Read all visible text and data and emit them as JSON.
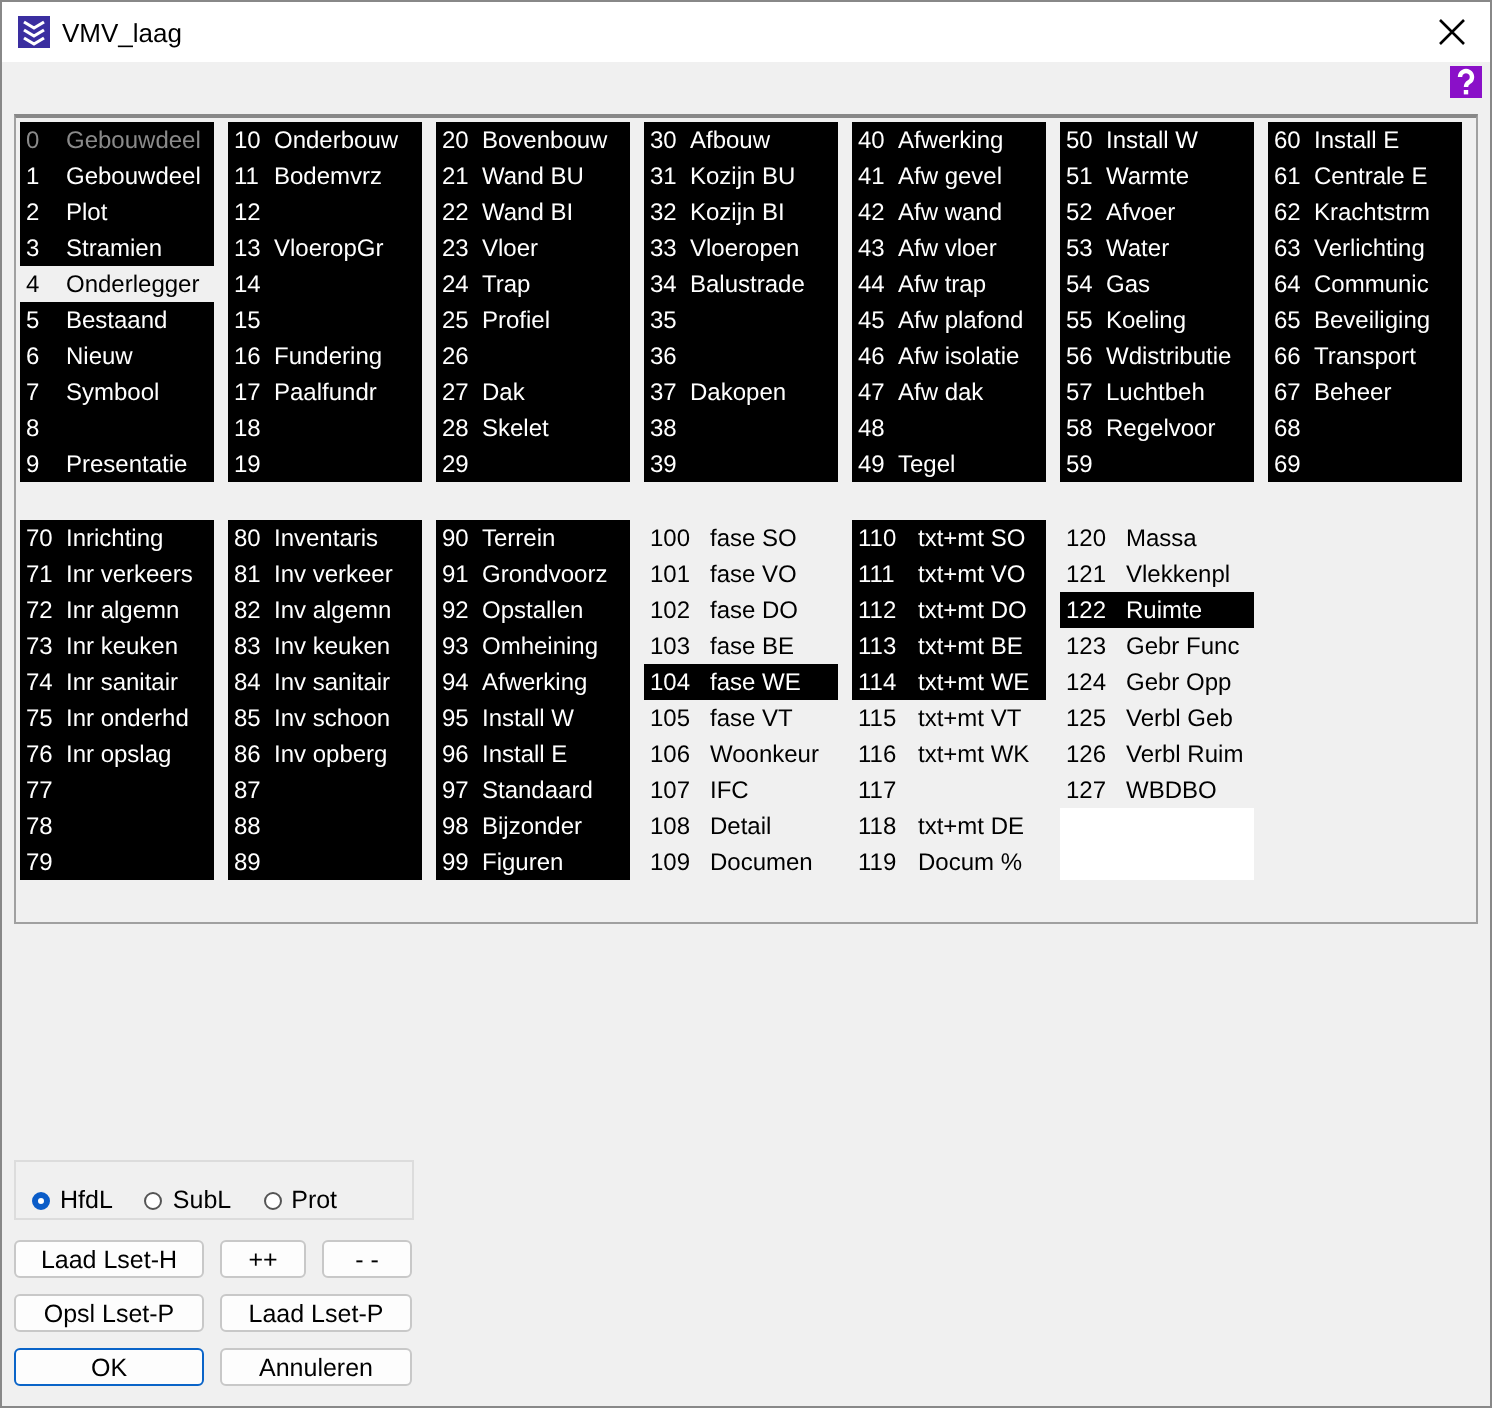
{
  "window": {
    "title": "VMV_laag"
  },
  "block_rows": [
    {
      "blocks": [
        {
          "items": [
            {
              "number": "0",
              "label": "Gebouwdeel",
              "on": true,
              "disabled": true
            },
            {
              "number": "1",
              "label": "Gebouwdeel",
              "on": true,
              "disabled": false
            },
            {
              "number": "2",
              "label": "Plot",
              "on": true,
              "disabled": false
            },
            {
              "number": "3",
              "label": "Stramien",
              "on": true,
              "disabled": false
            },
            {
              "number": "4",
              "label": "Onderlegger",
              "on": false,
              "disabled": false
            },
            {
              "number": "5",
              "label": "Bestaand",
              "on": true,
              "disabled": false
            },
            {
              "number": "6",
              "label": "Nieuw",
              "on": true,
              "disabled": false
            },
            {
              "number": "7",
              "label": "Symbool",
              "on": true,
              "disabled": false
            },
            {
              "number": "8",
              "on": true,
              "disabled": false
            },
            {
              "number": "9",
              "label": "Presentatie",
              "on": true,
              "disabled": false
            }
          ]
        },
        {
          "items": [
            {
              "number": "10",
              "label": "Onderbouw",
              "on": true,
              "disabled": false
            },
            {
              "number": "11",
              "label": "Bodemvrz",
              "on": true,
              "disabled": false
            },
            {
              "number": "12",
              "on": true,
              "disabled": false
            },
            {
              "number": "13",
              "label": "VloeropGr",
              "on": true,
              "disabled": false
            },
            {
              "number": "14",
              "on": true,
              "disabled": false
            },
            {
              "number": "15",
              "on": true,
              "disabled": false
            },
            {
              "number": "16",
              "label": "Fundering",
              "on": true,
              "disabled": false
            },
            {
              "number": "17",
              "label": "Paalfundr",
              "on": true,
              "disabled": false
            },
            {
              "number": "18",
              "on": true,
              "disabled": false
            },
            {
              "number": "19",
              "on": true,
              "disabled": false
            }
          ]
        },
        {
          "items": [
            {
              "number": "20",
              "label": "Bovenbouw",
              "on": true,
              "disabled": false
            },
            {
              "number": "21",
              "label": "Wand BU",
              "on": true,
              "disabled": false
            },
            {
              "number": "22",
              "label": "Wand BI",
              "on": true,
              "disabled": false
            },
            {
              "number": "23",
              "label": "Vloer",
              "on": true,
              "disabled": false
            },
            {
              "number": "24",
              "label": "Trap",
              "on": true,
              "disabled": false
            },
            {
              "number": "25",
              "label": "Profiel",
              "on": true,
              "disabled": false
            },
            {
              "number": "26",
              "on": true,
              "disabled": false
            },
            {
              "number": "27",
              "label": "Dak",
              "on": true,
              "disabled": false
            },
            {
              "number": "28",
              "label": "Skelet",
              "on": true,
              "disabled": false
            },
            {
              "number": "29",
              "on": true,
              "disabled": false
            }
          ]
        },
        {
          "items": [
            {
              "number": "30",
              "label": "Afbouw",
              "on": true,
              "disabled": false
            },
            {
              "number": "31",
              "label": "Kozijn BU",
              "on": true,
              "disabled": false
            },
            {
              "number": "32",
              "label": "Kozijn BI",
              "on": true,
              "disabled": false
            },
            {
              "number": "33",
              "label": "Vloeropen",
              "on": true,
              "disabled": false
            },
            {
              "number": "34",
              "label": "Balustrade",
              "on": true,
              "disabled": false
            },
            {
              "number": "35",
              "on": true,
              "disabled": false
            },
            {
              "number": "36",
              "on": true,
              "disabled": false
            },
            {
              "number": "37",
              "label": "Dakopen",
              "on": true,
              "disabled": false
            },
            {
              "number": "38",
              "on": true,
              "disabled": false
            },
            {
              "number": "39",
              "on": true,
              "disabled": false
            }
          ]
        },
        {
          "items": [
            {
              "number": "40",
              "label": "Afwerking",
              "on": true,
              "disabled": false
            },
            {
              "number": "41",
              "label": "Afw gevel",
              "on": true,
              "disabled": false
            },
            {
              "number": "42",
              "label": "Afw wand",
              "on": true,
              "disabled": false
            },
            {
              "number": "43",
              "label": "Afw vloer",
              "on": true,
              "disabled": false
            },
            {
              "number": "44",
              "label": "Afw trap",
              "on": true,
              "disabled": false
            },
            {
              "number": "45",
              "label": "Afw plafond",
              "on": true,
              "disabled": false
            },
            {
              "number": "46",
              "label": "Afw isolatie",
              "on": true,
              "disabled": false
            },
            {
              "number": "47",
              "label": "Afw dak",
              "on": true,
              "disabled": false
            },
            {
              "number": "48",
              "on": true,
              "disabled": false
            },
            {
              "number": "49",
              "label": "Tegel",
              "on": true,
              "disabled": false
            }
          ]
        },
        {
          "items": [
            {
              "number": "50",
              "label": "Install W",
              "on": true,
              "disabled": false
            },
            {
              "number": "51",
              "label": "Warmte",
              "on": true,
              "disabled": false
            },
            {
              "number": "52",
              "label": "Afvoer",
              "on": true,
              "disabled": false
            },
            {
              "number": "53",
              "label": "Water",
              "on": true,
              "disabled": false
            },
            {
              "number": "54",
              "label": "Gas",
              "on": true,
              "disabled": false
            },
            {
              "number": "55",
              "label": "Koeling",
              "on": true,
              "disabled": false
            },
            {
              "number": "56",
              "label": "Wdistributie",
              "on": true,
              "disabled": false
            },
            {
              "number": "57",
              "label": "Luchtbeh",
              "on": true,
              "disabled": false
            },
            {
              "number": "58",
              "label": "Regelvoor",
              "on": true,
              "disabled": false
            },
            {
              "number": "59",
              "on": true,
              "disabled": false
            }
          ]
        },
        {
          "items": [
            {
              "number": "60",
              "label": "Install E",
              "on": true,
              "disabled": false
            },
            {
              "number": "61",
              "label": "Centrale E",
              "on": true,
              "disabled": false
            },
            {
              "number": "62",
              "label": "Krachtstrm",
              "on": true,
              "disabled": false
            },
            {
              "number": "63",
              "label": "Verlichting",
              "on": true,
              "disabled": false
            },
            {
              "number": "64",
              "label": "Communic",
              "on": true,
              "disabled": false
            },
            {
              "number": "65",
              "label": "Beveiliging",
              "on": true,
              "disabled": false
            },
            {
              "number": "66",
              "label": "Transport",
              "on": true,
              "disabled": false
            },
            {
              "number": "67",
              "label": "Beheer",
              "on": true,
              "disabled": false
            },
            {
              "number": "68",
              "on": true,
              "disabled": false
            },
            {
              "number": "69",
              "on": true,
              "disabled": false
            }
          ]
        }
      ]
    },
    {
      "blocks": [
        {
          "items": [
            {
              "number": "70",
              "label": "Inrichting",
              "on": true,
              "disabled": false
            },
            {
              "number": "71",
              "label": "Inr verkeers",
              "on": true,
              "disabled": false
            },
            {
              "number": "72",
              "label": "Inr algemn",
              "on": true,
              "disabled": false
            },
            {
              "number": "73",
              "label": "Inr keuken",
              "on": true,
              "disabled": false
            },
            {
              "number": "74",
              "label": "Inr sanitair",
              "on": true,
              "disabled": false
            },
            {
              "number": "75",
              "label": "Inr onderhd",
              "on": true,
              "disabled": false
            },
            {
              "number": "76",
              "label": "Inr opslag",
              "on": true,
              "disabled": false
            },
            {
              "number": "77",
              "on": true,
              "disabled": false
            },
            {
              "number": "78",
              "on": true,
              "disabled": false
            },
            {
              "number": "79",
              "on": true,
              "disabled": false
            }
          ]
        },
        {
          "items": [
            {
              "number": "80",
              "label": "Inventaris",
              "on": true,
              "disabled": false
            },
            {
              "number": "81",
              "label": "Inv verkeer",
              "on": true,
              "disabled": false
            },
            {
              "number": "82",
              "label": "Inv algemn",
              "on": true,
              "disabled": false
            },
            {
              "number": "83",
              "label": "Inv keuken",
              "on": true,
              "disabled": false
            },
            {
              "number": "84",
              "label": "Inv sanitair",
              "on": true,
              "disabled": false
            },
            {
              "number": "85",
              "label": "Inv schoon",
              "on": true,
              "disabled": false
            },
            {
              "number": "86",
              "label": "Inv opberg",
              "on": true,
              "disabled": false
            },
            {
              "number": "87",
              "on": true,
              "disabled": false
            },
            {
              "number": "88",
              "on": true,
              "disabled": false
            },
            {
              "number": "89",
              "on": true,
              "disabled": false
            }
          ]
        },
        {
          "items": [
            {
              "number": "90",
              "label": "Terrein",
              "on": true,
              "disabled": false
            },
            {
              "number": "91",
              "label": "Grondvoorz",
              "on": true,
              "disabled": false
            },
            {
              "number": "92",
              "label": "Opstallen",
              "on": true,
              "disabled": false
            },
            {
              "number": "93",
              "label": "Omheining",
              "on": true,
              "disabled": false
            },
            {
              "number": "94",
              "label": "Afwerking",
              "on": true,
              "disabled": false
            },
            {
              "number": "95",
              "label": "Install W",
              "on": true,
              "disabled": false
            },
            {
              "number": "96",
              "label": "Install E",
              "on": true,
              "disabled": false
            },
            {
              "number": "97",
              "label": "Standaard",
              "on": true,
              "disabled": false
            },
            {
              "number": "98",
              "label": "Bijzonder",
              "on": true,
              "disabled": false
            },
            {
              "number": "99",
              "label": "Figuren",
              "on": true,
              "disabled": false
            }
          ]
        },
        {
          "items": [
            {
              "number": "100",
              "label": "fase SO",
              "on": false,
              "disabled": false
            },
            {
              "number": "101",
              "label": "fase VO",
              "on": false,
              "disabled": false
            },
            {
              "number": "102",
              "label": "fase DO",
              "on": false,
              "disabled": false
            },
            {
              "number": "103",
              "label": "fase BE",
              "on": false,
              "disabled": false
            },
            {
              "number": "104",
              "label": "fase WE",
              "on": true,
              "disabled": false
            },
            {
              "number": "105",
              "label": "fase VT",
              "on": false,
              "disabled": false
            },
            {
              "number": "106",
              "label": "Woonkeur",
              "on": false,
              "disabled": false
            },
            {
              "number": "107",
              "label": "IFC",
              "on": false,
              "disabled": false
            },
            {
              "number": "108",
              "label": "Detail",
              "on": false,
              "disabled": false
            },
            {
              "number": "109",
              "label": "Documen",
              "on": false,
              "disabled": false
            }
          ]
        },
        {
          "items": [
            {
              "number": "110",
              "label": "txt+mt SO",
              "on": true,
              "disabled": false
            },
            {
              "number": "111",
              "label": "txt+mt VO",
              "on": true,
              "disabled": false
            },
            {
              "number": "112",
              "label": "txt+mt DO",
              "on": true,
              "disabled": false
            },
            {
              "number": "113",
              "label": "txt+mt BE",
              "on": true,
              "disabled": false
            },
            {
              "number": "114",
              "label": "txt+mt WE",
              "on": true,
              "disabled": false
            },
            {
              "number": "115",
              "label": "txt+mt VT",
              "on": false,
              "disabled": false
            },
            {
              "number": "116",
              "label": "txt+mt WK",
              "on": false,
              "disabled": false
            },
            {
              "number": "117",
              "on": false,
              "disabled": false
            },
            {
              "number": "118",
              "label": "txt+mt DE",
              "on": false,
              "disabled": false
            },
            {
              "number": "119",
              "label": "Docum %",
              "on": false,
              "disabled": false
            }
          ]
        },
        {
          "items": [
            {
              "number": "120",
              "label": "Massa",
              "on": false,
              "disabled": false
            },
            {
              "number": "121",
              "label": "Vlekkenpl",
              "on": false,
              "disabled": false
            },
            {
              "number": "122",
              "label": "Ruimte",
              "on": true,
              "disabled": false
            },
            {
              "number": "123",
              "label": "Gebr Func",
              "on": false,
              "disabled": false
            },
            {
              "number": "124",
              "label": "Gebr Opp",
              "on": false,
              "disabled": false
            },
            {
              "number": "125",
              "label": "Verbl Geb",
              "on": false,
              "disabled": false
            },
            {
              "number": "126",
              "label": "Verbl Ruim",
              "on": false,
              "disabled": false
            },
            {
              "number": "127",
              "label": "WBDBO",
              "on": false,
              "disabled": false
            }
          ]
        }
      ]
    }
  ],
  "layer_mode": [
    {
      "label": "HfdL",
      "selected": true
    },
    {
      "label": "SubL",
      "selected": false
    },
    {
      "label": "Prot",
      "selected": false
    }
  ],
  "button_rows": [
    {
      "buttons": [
        {
          "label": "Laad Lset-H",
          "focused": false
        },
        {
          "label": "++",
          "focused": false
        },
        {
          "label": "- -",
          "focused": false
        }
      ]
    },
    {
      "buttons": [
        {
          "label": "Opsl Lset-P",
          "focused": false
        },
        {
          "label": "Laad Lset-P",
          "focused": false
        }
      ]
    },
    {
      "buttons": [
        {
          "label": "OK",
          "focused": true
        },
        {
          "label": "Annuleren",
          "focused": false
        }
      ]
    }
  ]
}
